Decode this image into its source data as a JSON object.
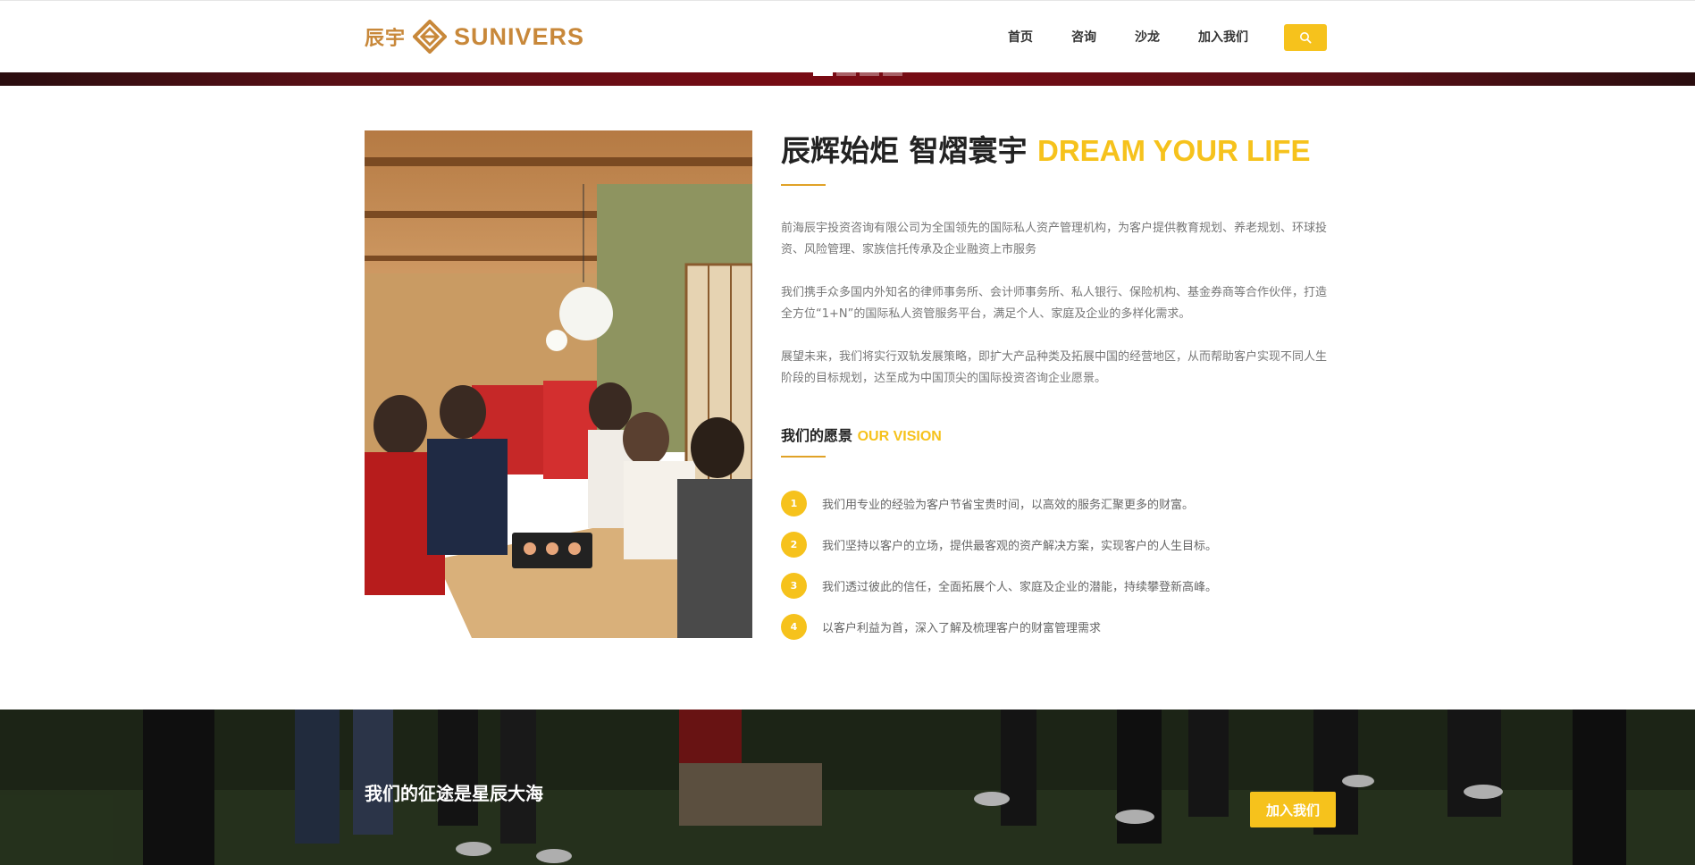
{
  "brand": {
    "name_cn": "辰宇",
    "name_en": "SUNIVERS",
    "color": "#c8883a"
  },
  "nav": {
    "items": [
      {
        "label": "首页"
      },
      {
        "label": "咨询"
      },
      {
        "label": "沙龙"
      },
      {
        "label": "加入我们"
      }
    ],
    "search_icon": "search-icon"
  },
  "carousel": {
    "slides": 4,
    "active": 1
  },
  "about": {
    "title_cn": "辰辉始炬 智熠寰宇 ",
    "title_en": "DREAM YOUR LIFE",
    "paragraphs": [
      "前海辰宇投资咨询有限公司为全国领先的国际私人资产管理机构，为客户提供教育规划、养老规划、环球投资、风险管理、家族信托传承及企业融资上市服务",
      "我们携手众多国内外知名的律师事务所、会计师事务所、私人银行、保险机构、基金券商等合作伙伴，打造全方位“1+N”的国际私人资管服务平台，满足个人、家庭及企业的多样化需求。",
      "展望未来，我们将实行双轨发展策略，即扩大产品种类及拓展中国的经营地区，从而帮助客户实现不同人生阶段的目标规划，达至成为中国顶尖的国际投资咨询企业愿景。"
    ]
  },
  "vision": {
    "title_cn": "我们的愿景 ",
    "title_en": "OUR VISION",
    "items": [
      {
        "num": "1",
        "text": "我们用专业的经验为客户节省宝贵时间，以高效的服务汇聚更多的财富。"
      },
      {
        "num": "2",
        "text": "我们坚持以客户的立场，提供最客观的资产解决方案，实现客户的人生目标。"
      },
      {
        "num": "3",
        "text": "我们透过彼此的信任，全面拓展个人、家庭及企业的潜能，持续攀登新高峰。"
      },
      {
        "num": "4",
        "text": "以客户利益为首，深入了解及梳理客户的财富管理需求"
      }
    ]
  },
  "banner": {
    "title": "我们的征途是星辰大海",
    "button_label": "加入我们"
  },
  "colors": {
    "accent": "#f6c21c",
    "underline": "#e0a227"
  }
}
